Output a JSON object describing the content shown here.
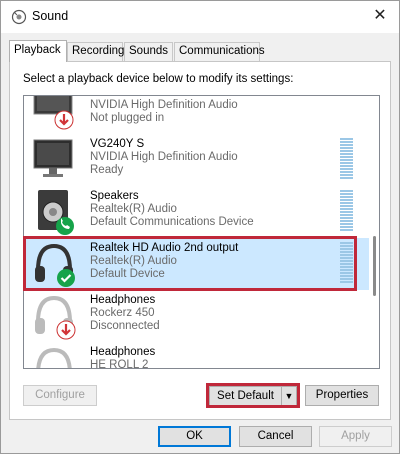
{
  "window": {
    "title": "Sound",
    "close_glyph": "✕"
  },
  "tabs": [
    {
      "label": "Playback",
      "active": true
    },
    {
      "label": "Recording",
      "active": false
    },
    {
      "label": "Sounds",
      "active": false
    },
    {
      "label": "Communications",
      "active": false
    }
  ],
  "instruction": "Select a playback device below to modify its settings:",
  "devices": [
    {
      "name": "",
      "driver": "NVIDIA High Definition Audio",
      "status": "Not plugged in",
      "icon": "monitor-icon",
      "badge": "red-down-arrow-badge"
    },
    {
      "name": "VG240Y S",
      "driver": "NVIDIA High Definition Audio",
      "status": "Ready",
      "icon": "monitor-icon",
      "badge": ""
    },
    {
      "name": "Speakers",
      "driver": "Realtek(R) Audio",
      "status": "Default Communications Device",
      "icon": "speaker-icon",
      "badge": "green-phone-badge"
    },
    {
      "name": "Realtek HD Audio 2nd output",
      "driver": "Realtek(R) Audio",
      "status": "Default Device",
      "icon": "headphones-icon",
      "badge": "green-check-badge",
      "selected": true
    },
    {
      "name": "Headphones",
      "driver": "Rockerz 450",
      "status": "Disconnected",
      "icon": "headphones-icon",
      "badge": "red-down-arrow-badge"
    },
    {
      "name": "Headphones",
      "driver": "HE ROLL 2",
      "status": "",
      "icon": "headphones-icon",
      "badge": ""
    }
  ],
  "buttons": {
    "configure": "Configure",
    "set_default": "Set Default",
    "set_default_arrow": "▼",
    "properties": "Properties",
    "ok": "OK",
    "cancel": "Cancel",
    "apply": "Apply"
  },
  "colors": {
    "accent": "#0078d7",
    "selection": "#cce8ff",
    "highlight_annotation": "#c0283a"
  }
}
